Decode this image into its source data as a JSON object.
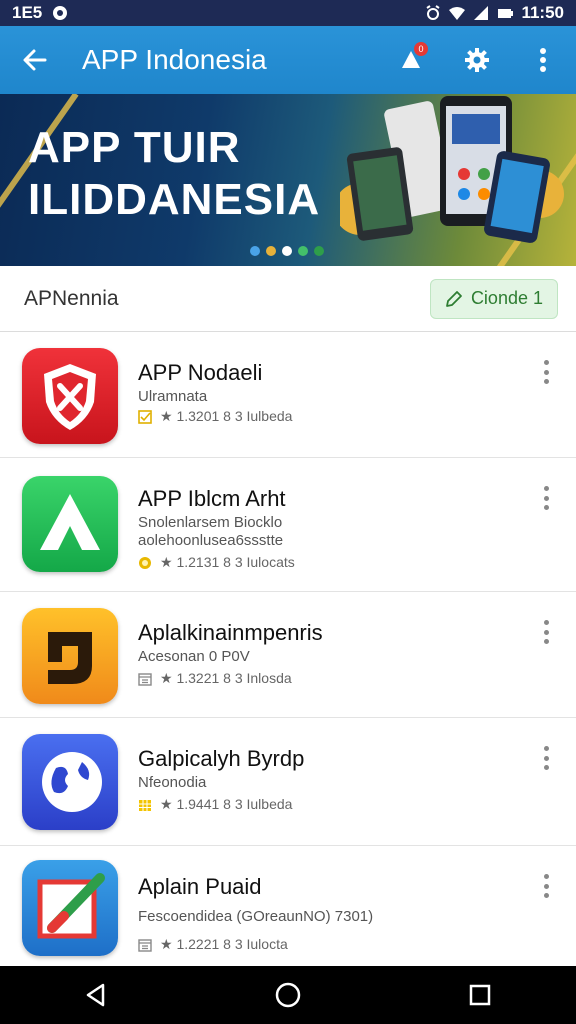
{
  "status_bar": {
    "left_text": "1E5",
    "time": "11:50",
    "icons": [
      "notification-icon",
      "alarm-icon",
      "wifi-icon",
      "signal-icon",
      "battery-icon"
    ]
  },
  "app_bar": {
    "title": "APP Indonesia",
    "notification_count": "0",
    "icons": [
      "back-arrow-icon",
      "notification-bell-icon",
      "settings-gear-icon",
      "overflow-menu-icon"
    ]
  },
  "banner": {
    "line1": "APP TUIR",
    "line2": "ILIDDANESIA",
    "carousel_dots": 5
  },
  "section": {
    "label": "APNennia",
    "chip_label": "Cionde 1"
  },
  "apps": [
    {
      "title": "APP Nodaeli",
      "subtitle_lines": [
        "Ulramnata"
      ],
      "meta": "★ 1.3201 8 3 Iulbeda",
      "meta_icon": "check-box-icon",
      "icon_colors": [
        "#f0323a",
        "#c8141c"
      ]
    },
    {
      "title": "APP Iblcm Arht",
      "subtitle_lines": [
        "Snolenlarsem Biocklo",
        "aolehoonlusea6ssstte"
      ],
      "meta": "★ 1.2131 8 3 Iulocats",
      "meta_icon": "coin-icon",
      "icon_colors": [
        "#3ad46a",
        "#14a848"
      ]
    },
    {
      "title": "Aplalkinainmpenris",
      "subtitle_lines": [
        "Acesonan 0 P0V"
      ],
      "meta": "★ 1.3221 8 3 Inlosda",
      "meta_icon": "calendar-icon",
      "icon_colors": [
        "#ffc12a",
        "#f08a1a"
      ]
    },
    {
      "title": "Galpicalyh Byrdp",
      "subtitle_lines": [
        "Nfeonodia"
      ],
      "meta": "★ 1.9441 8 3 Iulbeda",
      "meta_icon": "grid-icon",
      "icon_colors": [
        "#4a6ff0",
        "#2b3fc8"
      ]
    },
    {
      "title": "Aplain Puaid",
      "subtitle_lines": [
        "Fescoendidea (GOreaunNO) 7301)"
      ],
      "meta": "★ 1.2221 8 3 Iulocta",
      "meta_icon": "calendar-icon",
      "icon_colors": [
        "#3aa0e8",
        "#1e6fc8"
      ]
    }
  ],
  "nav_bar": {
    "icons": [
      "back-triangle-icon",
      "home-circle-icon",
      "recents-square-icon"
    ]
  },
  "colors": {
    "status_bar": "#1e2a55",
    "app_bar": "#2a93d8",
    "chip_bg": "#e3f5e4",
    "chip_text": "#2e7d32"
  }
}
